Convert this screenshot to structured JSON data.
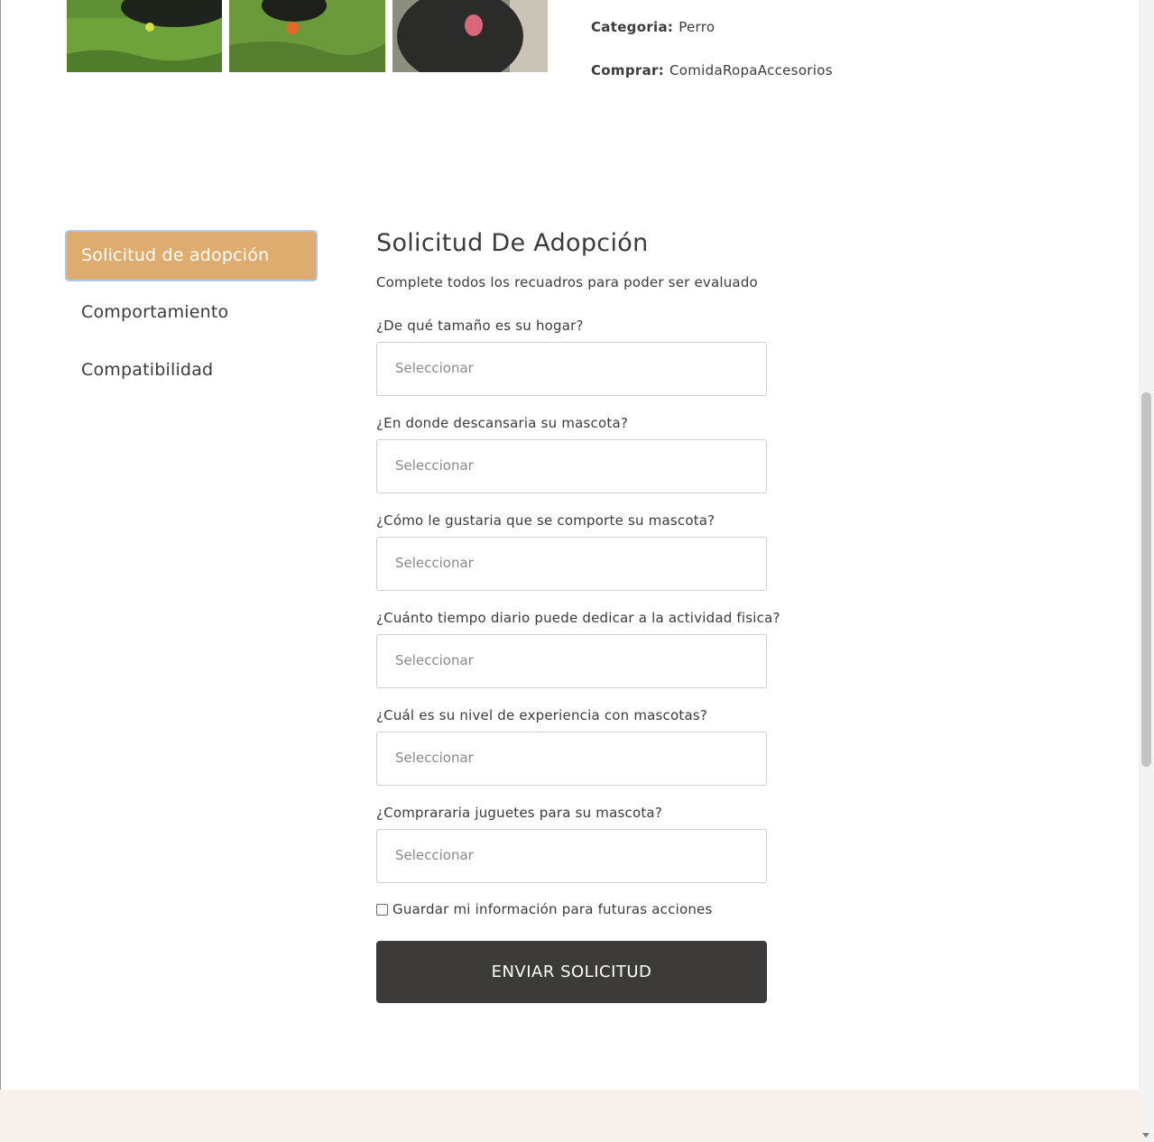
{
  "gallery": {
    "images": [
      {
        "icon": "dog-photo-1"
      },
      {
        "icon": "dog-photo-2"
      },
      {
        "icon": "dog-photo-3"
      }
    ]
  },
  "meta": {
    "category_key": "Categoria:",
    "category_value": "Perro",
    "buy_key": "Comprar:",
    "buy_value": "ComidaRopaAccesorios"
  },
  "tabs": [
    {
      "label": "Solicitud de adopción",
      "active": true
    },
    {
      "label": "Comportamiento",
      "active": false
    },
    {
      "label": "Compatibilidad",
      "active": false
    }
  ],
  "form": {
    "title": "Solicitud De Adopción",
    "subtitle": "Complete todos los recuadros para poder ser evaluado",
    "questions": [
      {
        "label": "¿De qué tamaño es su hogar?",
        "value": "Seleccionar"
      },
      {
        "label": "¿En donde descansaria su mascota?",
        "value": "Seleccionar"
      },
      {
        "label": "¿Cómo le gustaria que se comporte su mascota?",
        "value": "Seleccionar"
      },
      {
        "label": "¿Cuánto tiempo diario puede dedicar a la actividad fisica?",
        "value": "Seleccionar"
      },
      {
        "label": "¿Cuál es su nivel de experiencia con mascotas?",
        "value": "Seleccionar"
      },
      {
        "label": "¿Comprararia juguetes para su mascota?",
        "value": "Seleccionar"
      }
    ],
    "save_label": "Guardar mi información para futuras acciones",
    "save_checked": false,
    "submit_label": "ENVIAR SOLICITUD"
  },
  "colors": {
    "accent": "#deac6e",
    "button": "#3c3b3a",
    "footer": "#f8f1eb"
  }
}
